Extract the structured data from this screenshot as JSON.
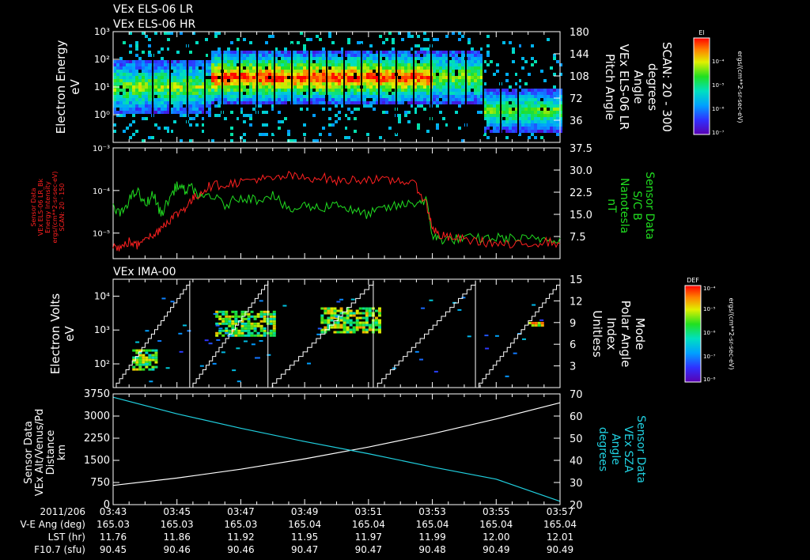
{
  "titles": [
    "VEx ELS-06 LR",
    "VEx ELS-06 HR"
  ],
  "chart_data": [
    {
      "type": "heatmap",
      "left_label": [
        "Electron Energy",
        "eV"
      ],
      "right_label": [
        "Pitch Angle",
        "VEx ELS-06 LR",
        "Angle",
        "degrees",
        "SCAN: 20 - 300"
      ],
      "y_ticks_left": [
        {
          "v": 1,
          "t": "10⁰"
        },
        {
          "v": 2,
          "t": "10¹"
        },
        {
          "v": 3,
          "t": "10²"
        },
        {
          "v": 4,
          "t": "10³"
        }
      ],
      "ylim": [
        0,
        4
      ],
      "y_ticks_right": [
        "180",
        "144",
        "108",
        "72",
        "36"
      ],
      "colorbar": {
        "title": "El",
        "ticks": [
          "10⁻⁴",
          "10⁻⁵",
          "10⁻⁶",
          "10⁻⁷"
        ],
        "units": "ergs/(cm**2-sr-sec-eV)"
      }
    },
    {
      "type": "line",
      "left_label": [
        "Sensor Data",
        "VEx ELS-06 LR_Bk",
        "Energy Intensity",
        "ergs/(cm**2-sr-sec-eV)",
        "SCAN: 20 - 150"
      ],
      "right_label": [
        "Sensor Data",
        "S/C B",
        "Nanotesla",
        "nT"
      ],
      "y_ticks_left": [
        {
          "v": -5,
          "t": "10⁻⁵"
        },
        {
          "v": -4,
          "t": "10⁻⁴"
        },
        {
          "v": -3,
          "t": "10⁻³"
        }
      ],
      "ylim_log": [
        -5.6,
        -3
      ],
      "y_ticks_right": [
        {
          "v": 7.5,
          "t": "7.5"
        },
        {
          "v": 15,
          "t": "15.0"
        },
        {
          "v": 22.5,
          "t": "22.5"
        },
        {
          "v": 30,
          "t": "30.0"
        },
        {
          "v": 37.5,
          "t": "37.5"
        }
      ],
      "ylim_right": [
        0,
        37.5
      ],
      "series": [
        {
          "color": "#ff2020",
          "x": [
            0,
            0.25,
            0.5,
            0.75,
            1.0,
            1.25,
            1.5,
            1.75,
            2.0,
            2.25,
            2.5,
            2.75,
            3.0,
            3.5,
            4.0,
            4.5,
            5.0,
            5.5,
            6.0,
            6.5,
            7.0,
            7.5,
            8.0,
            8.5,
            9.0,
            9.5,
            9.8,
            10.0,
            10.2,
            10.5,
            11.0,
            11.5,
            12.0,
            12.5,
            13.0,
            13.5,
            14.0
          ],
          "y": [
            -5.3,
            -5.35,
            -5.2,
            -5.3,
            -5.05,
            -5.1,
            -4.85,
            -4.7,
            -4.55,
            -4.4,
            -4.2,
            -4.05,
            -3.9,
            -3.85,
            -3.8,
            -3.72,
            -3.75,
            -3.65,
            -3.72,
            -3.68,
            -3.78,
            -3.75,
            -3.72,
            -3.78,
            -3.75,
            -3.9,
            -4.3,
            -4.85,
            -5.05,
            -5.1,
            -5.15,
            -5.2,
            -5.25,
            -5.3,
            -5.25,
            -5.2,
            -5.25
          ]
        },
        {
          "color": "#20dd20",
          "x": [
            0,
            0.25,
            0.5,
            0.75,
            1.0,
            1.25,
            1.5,
            1.75,
            2.0,
            2.25,
            2.5,
            2.75,
            3.0,
            3.5,
            4.0,
            4.5,
            5.0,
            5.5,
            6.0,
            6.5,
            7.0,
            7.5,
            8.0,
            8.5,
            9.0,
            9.5,
            9.8,
            10.0,
            10.2,
            10.5,
            11.0,
            11.5,
            12.0,
            12.5,
            13.0,
            13.5,
            14.0
          ],
          "y": [
            17,
            15,
            20,
            23,
            18,
            22,
            15,
            20,
            25,
            23,
            24,
            20,
            22,
            18,
            21,
            20,
            22,
            16,
            18,
            17,
            19,
            16,
            15,
            17,
            18,
            19,
            20,
            8,
            6.5,
            6.5,
            6.8,
            6.8,
            7,
            6.8,
            6.5,
            6.8,
            7
          ]
        }
      ]
    },
    {
      "type": "heatmap",
      "title": "VEx IMA-00",
      "left_label": [
        "Electron Volts",
        "eV"
      ],
      "right_label": [
        "Mode",
        "Polar Angle",
        "Index",
        "Unitless"
      ],
      "y_ticks_left": [
        {
          "v": 2,
          "t": "10²"
        },
        {
          "v": 3,
          "t": "10³"
        },
        {
          "v": 4,
          "t": "10⁴"
        }
      ],
      "ylim": [
        1.3,
        4.5
      ],
      "y_ticks_right": [
        {
          "v": 3,
          "t": "3"
        },
        {
          "v": 6,
          "t": "6"
        },
        {
          "v": 9,
          "t": "9"
        },
        {
          "v": 12,
          "t": "12"
        },
        {
          "v": 15,
          "t": "15"
        }
      ],
      "ylim_right": [
        0,
        15
      ],
      "colorbar": {
        "title": "DEF",
        "ticks": [
          "10⁻⁴",
          "10⁻⁵",
          "10⁻⁶",
          "10⁻⁷",
          "10⁻⁸"
        ],
        "units": "ergs/(cm**2-sr-sec-eV)"
      }
    },
    {
      "type": "line",
      "left_label": [
        "Sensor Data",
        "VEx Alt/Venus/Pd",
        "Distance",
        "km"
      ],
      "right_label": [
        "Sensor Data",
        "VEx SZA",
        "Angle",
        "degrees"
      ],
      "y_ticks_left": [
        {
          "v": 0,
          "t": "0"
        },
        {
          "v": 750,
          "t": "750"
        },
        {
          "v": 1500,
          "t": "1500"
        },
        {
          "v": 2250,
          "t": "2250"
        },
        {
          "v": 3000,
          "t": "3000"
        },
        {
          "v": 3750,
          "t": "3750"
        }
      ],
      "ylim": [
        0,
        3750
      ],
      "y_ticks_right": [
        {
          "v": 20,
          "t": "20"
        },
        {
          "v": 30,
          "t": "30"
        },
        {
          "v": 40,
          "t": "40"
        },
        {
          "v": 50,
          "t": "50"
        },
        {
          "v": 60,
          "t": "60"
        },
        {
          "v": 70,
          "t": "70"
        }
      ],
      "ylim_right": [
        20,
        70
      ],
      "series": [
        {
          "color": "#ffffff",
          "x": [
            0,
            2,
            4,
            6,
            8,
            10,
            12,
            14
          ],
          "y": [
            650,
            900,
            1200,
            1550,
            1950,
            2400,
            2900,
            3450
          ]
        },
        {
          "color": "#20d0e0",
          "axis": "right",
          "x": [
            0,
            2,
            4,
            6,
            8,
            10,
            12,
            14
          ],
          "y": [
            68.5,
            61,
            54.5,
            48.5,
            43,
            37,
            31.5,
            21.5
          ]
        }
      ]
    }
  ],
  "xaxis": {
    "range_minutes": [
      0,
      14
    ],
    "tick_labels": [
      "03:43",
      "03:45",
      "03:47",
      "03:49",
      "03:51",
      "03:53",
      "03:55",
      "03:57"
    ]
  },
  "ephemeris": {
    "labels": [
      "2011/206",
      "V-E Ang (deg)",
      "LST (hr)",
      "F10.7 (sfu)"
    ],
    "rows": [
      [
        "165.03",
        "165.03",
        "165.03",
        "165.04",
        "165.04",
        "165.04",
        "165.04",
        "165.04"
      ],
      [
        "11.76",
        "11.86",
        "11.92",
        "11.95",
        "11.97",
        "11.99",
        "12.00",
        "12.01"
      ],
      [
        "90.45",
        "90.46",
        "90.46",
        "90.47",
        "90.47",
        "90.48",
        "90.49",
        "90.49"
      ]
    ]
  }
}
